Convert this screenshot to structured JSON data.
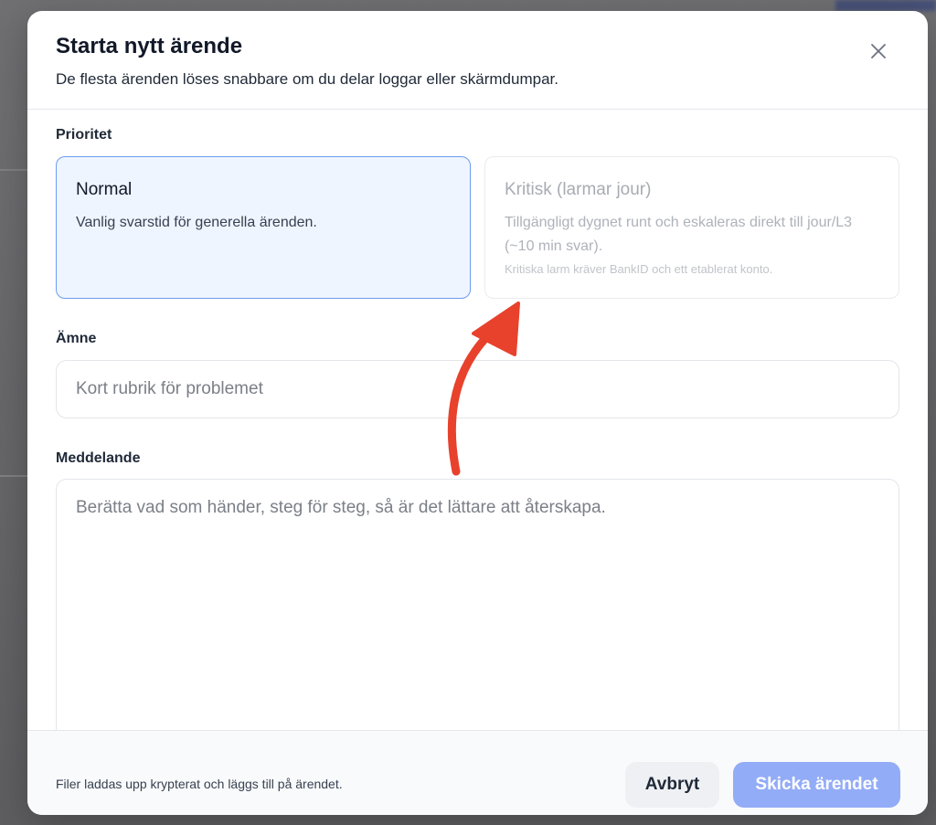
{
  "modal": {
    "title": "Starta nytt ärende",
    "subtitle": "De flesta ärenden löses snabbare om du delar loggar eller skärmdumpar.",
    "close_icon": "close-icon"
  },
  "priority": {
    "label": "Prioritet",
    "selected": "normal",
    "options": [
      {
        "id": "normal",
        "title": "Normal",
        "description": "Vanlig svarstid för generella ärenden.",
        "enabled": true
      },
      {
        "id": "critical",
        "title": "Kritisk (larmar jour)",
        "description": "Tillgängligt dygnet runt och eskaleras direkt till jour/L3 (~10 min svar).",
        "note": "Kritiska larm kräver BankID och ett etablerat konto.",
        "enabled": false
      }
    ]
  },
  "subject": {
    "label": "Ämne",
    "placeholder": "Kort rubrik för problemet",
    "value": ""
  },
  "message": {
    "label": "Meddelande",
    "placeholder": "Berätta vad som händer, steg för steg, så är det lättare att återskapa.",
    "value": ""
  },
  "footer": {
    "note": "Filer laddas upp krypterat och läggs till på ärendet.",
    "cancel_label": "Avbryt",
    "submit_label": "Skicka ärendet"
  },
  "colors": {
    "accent": "#6b9cf0",
    "selected_bg": "#eff5ff",
    "submit_disabled": "#93acf7",
    "annotation": "#e8412c"
  }
}
